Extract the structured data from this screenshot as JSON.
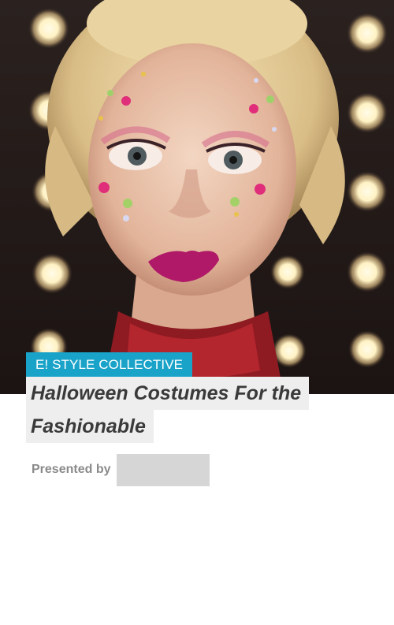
{
  "article": {
    "category_tag": "E! STYLE COLLECTIVE",
    "title_line_1": "Halloween Costumes For the",
    "title_line_2": "Fashionable"
  },
  "sponsor": {
    "presented_by_label": "Presented by"
  },
  "colors": {
    "tag_background": "#1aa3c9",
    "title_highlight": "#eeeeee",
    "sponsor_placeholder": "#d6d6d6"
  }
}
